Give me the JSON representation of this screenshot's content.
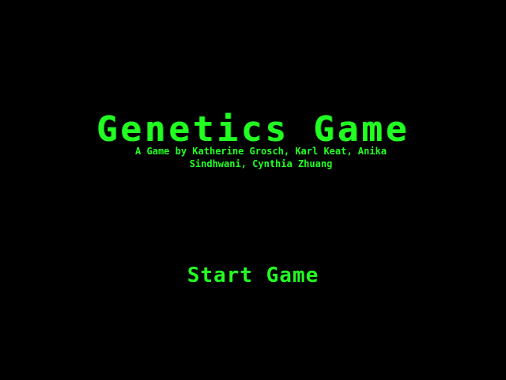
{
  "game": {
    "title": "Genetics Game",
    "credits": "A Game by Katherine Grosch, Karl Keat, Anika Sindhwani, Cynthia Zhuang",
    "start_label": "Start Game"
  },
  "colors": {
    "background": "#000000",
    "text": "#22ff22"
  }
}
